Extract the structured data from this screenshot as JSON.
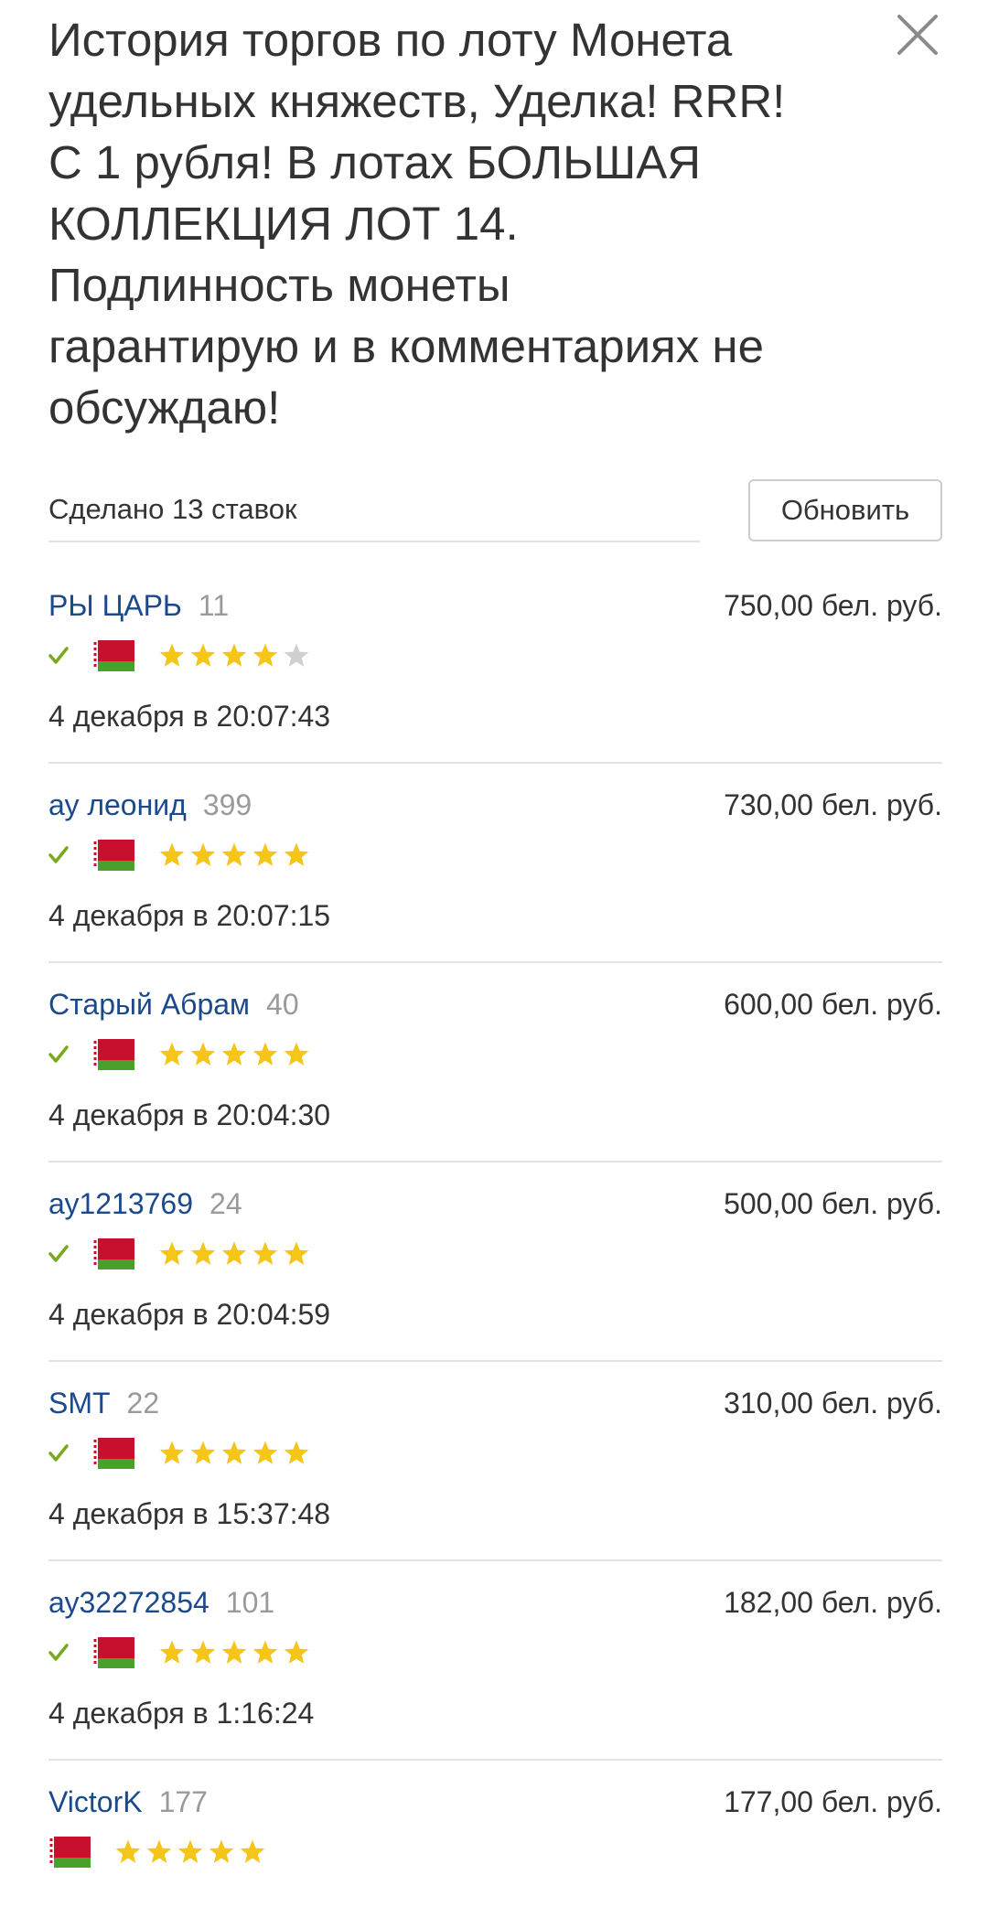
{
  "header": {
    "title": "История торгов по лоту Монета\nудельных княжеств, Уделка! RRR!\nС 1 рубля! В лотах БОЛЬШАЯ\nКОЛЛЕКЦИЯ ЛОТ 14.\nПодлинность монеты\nгарантирую и в комментариях не\nобсуждаю!",
    "close_icon": "close-icon"
  },
  "summary": {
    "bids_count_text": "Сделано 13 ставок",
    "refresh_label": "Обновить"
  },
  "colors": {
    "username": "#1b4a8c",
    "rating": "#9a9a9a",
    "check": "#7aa81e",
    "star_filled": "#f5c518",
    "star_empty": "#d0d0d0",
    "divider": "#e2e2e2",
    "flag_red": "#c8102e",
    "flag_green": "#4aa02c"
  },
  "bids": [
    {
      "username": "РЫ ЦАРЬ",
      "rating": "11",
      "amount": "750,00 бел. руб.",
      "verified": true,
      "flag": "belarus-flag-icon",
      "stars": 4,
      "datetime": "4 декабря в 20:07:43"
    },
    {
      "username": "ау леонид",
      "rating": "399",
      "amount": "730,00 бел. руб.",
      "verified": true,
      "flag": "belarus-flag-icon",
      "stars": 5,
      "datetime": "4 декабря в 20:07:15"
    },
    {
      "username": "Старый Абрам",
      "rating": "40",
      "amount": "600,00 бел. руб.",
      "verified": true,
      "flag": "belarus-flag-icon",
      "stars": 5,
      "datetime": "4 декабря в 20:04:30"
    },
    {
      "username": "ау1213769",
      "rating": "24",
      "amount": "500,00 бел. руб.",
      "verified": true,
      "flag": "belarus-flag-icon",
      "stars": 5,
      "datetime": "4 декабря в 20:04:59"
    },
    {
      "username": "SMT",
      "rating": "22",
      "amount": "310,00 бел. руб.",
      "verified": true,
      "flag": "belarus-flag-icon",
      "stars": 5,
      "datetime": "4 декабря в 15:37:48"
    },
    {
      "username": "ау32272854",
      "rating": "101",
      "amount": "182,00 бел. руб.",
      "verified": true,
      "flag": "belarus-flag-icon",
      "stars": 5,
      "datetime": "4 декабря в 1:16:24"
    },
    {
      "username": "VictorK",
      "rating": "177",
      "amount": "177,00 бел. руб.",
      "verified": false,
      "flag": "belarus-flag-icon",
      "stars": 5,
      "datetime": ""
    }
  ]
}
